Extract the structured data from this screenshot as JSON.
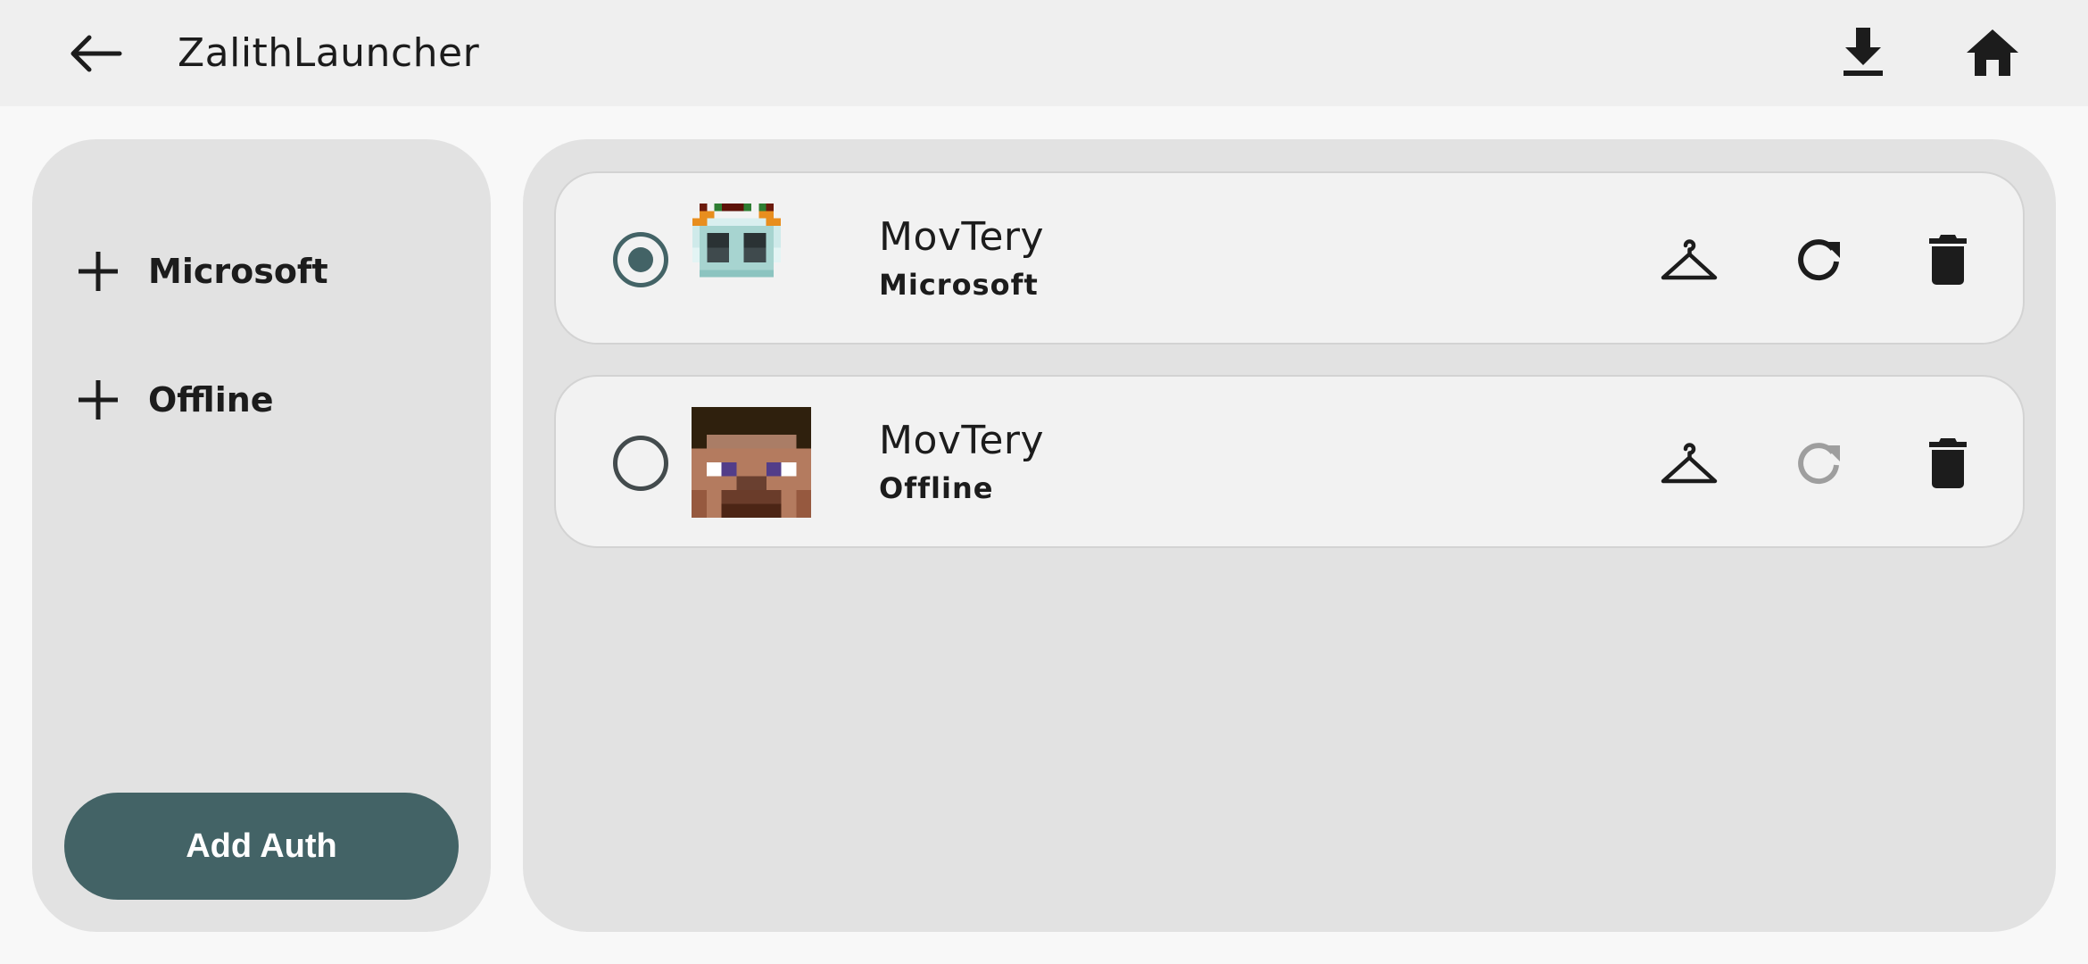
{
  "header": {
    "title": "ZalithLauncher",
    "back_icon": "arrow-back-icon",
    "download_icon": "download-icon",
    "home_icon": "home-icon"
  },
  "sidebar": {
    "options": [
      {
        "label": "Microsoft",
        "icon": "plus-icon"
      },
      {
        "label": "Offline",
        "icon": "plus-icon"
      }
    ],
    "add_button_label": "Add Auth"
  },
  "accounts": [
    {
      "name": "MovTery",
      "type": "Microsoft",
      "selected": true,
      "skin_icon": "hanger-icon",
      "refresh_enabled": true,
      "delete_icon": "trash-icon"
    },
    {
      "name": "MovTery",
      "type": "Offline",
      "selected": false,
      "skin_icon": "hanger-icon",
      "refresh_enabled": false,
      "delete_icon": "trash-icon"
    }
  ],
  "colors": {
    "accent": "#436366",
    "panel": "#e2e2e2",
    "card": "#f2f2f2",
    "topbar": "#efefef",
    "icon": "#1c1c1c",
    "icon_disabled": "#9e9e9e"
  }
}
